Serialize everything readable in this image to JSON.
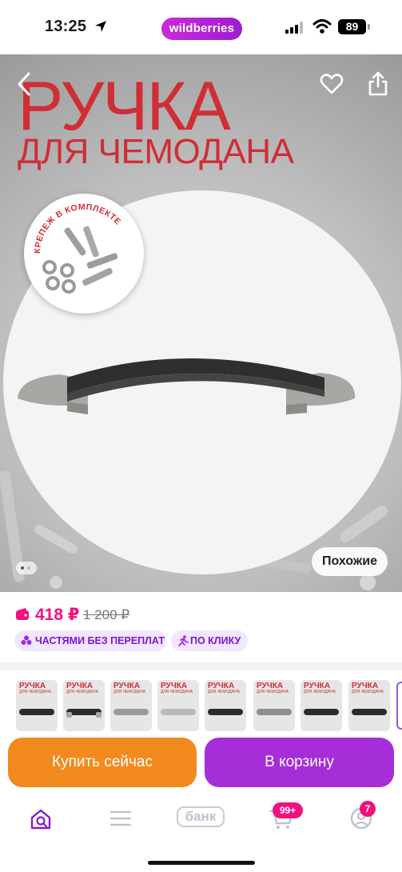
{
  "status_bar": {
    "time": "13:25",
    "brand": "wildberries",
    "battery": "89"
  },
  "product": {
    "title_line1": "РУЧКА",
    "title_line2": "ДЛЯ ЧЕМОДАНА",
    "circle_label": "КРЕПЕЖ В КОМПЛЕКТЕ",
    "similar_label": "Похожие",
    "gallery_dots": 2,
    "gallery_active": 1
  },
  "price": {
    "current": "418 ₽",
    "old": "1 200 ₽"
  },
  "chips": [
    {
      "label": "ЧАСТЯМИ БЕЗ ПЕРЕПЛАТ",
      "icon": "installments-icon"
    },
    {
      "label": "ПО КЛИКУ",
      "icon": "running-person-icon"
    }
  ],
  "thumbnails": [
    {
      "title": "РУЧКА",
      "subtitle": "ДЛЯ ЧЕМОДАНА"
    },
    {
      "title": "РУЧКА",
      "subtitle": "ДЛЯ ЧЕМОДАНА"
    },
    {
      "title": "РУЧКА",
      "subtitle": "ДЛЯ ЧЕМОДАНА"
    },
    {
      "title": "РУЧКА",
      "subtitle": "ДЛЯ ЧЕМОДАНА"
    },
    {
      "title": "РУЧКА",
      "subtitle": "ДЛЯ ЧЕМОДАНА"
    },
    {
      "title": "РУЧКА",
      "subtitle": "ДЛЯ ЧЕМОДАНА"
    },
    {
      "title": "РУЧКА",
      "subtitle": "ДЛЯ ЧЕМОДАНА"
    },
    {
      "title": "РУЧКА",
      "subtitle": "ДЛЯ ЧЕМОДАНА"
    }
  ],
  "actions": {
    "buy_now": "Купить сейчас",
    "add_to_cart": "В корзину"
  },
  "tabbar": {
    "bank_label": "банк",
    "cart_badge": "99+",
    "profile_badge": "7",
    "items": [
      "home-search-icon",
      "menu-icon",
      "bank-icon",
      "cart-icon",
      "profile-icon"
    ]
  },
  "colors": {
    "accent_purple": "#a52ed9",
    "accent_orange": "#f28a1e",
    "price_pink": "#f1117e",
    "title_red": "#cf2e35"
  }
}
